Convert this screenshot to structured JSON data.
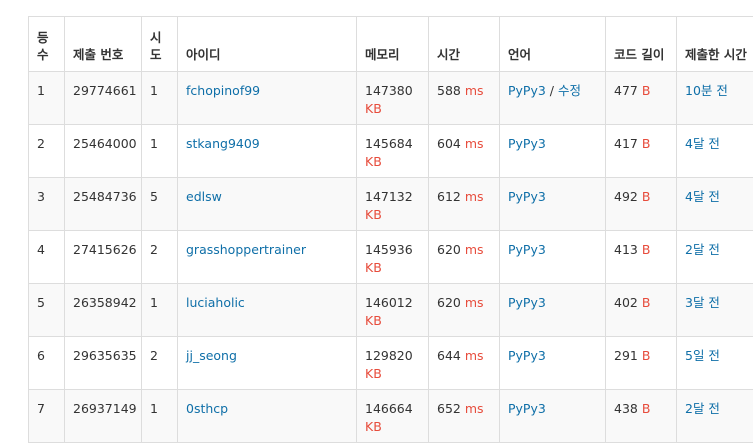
{
  "headers": {
    "rank": "등수",
    "submission_id": "제출 번호",
    "attempts": "시도",
    "user_id": "아이디",
    "memory": "메모리",
    "time": "시간",
    "language": "언어",
    "code_length": "코드 길이",
    "submitted_at": "제출한 시간"
  },
  "units": {
    "memory": "KB",
    "time": "ms",
    "code": "B"
  },
  "rows": [
    {
      "rank": "1",
      "submission_id": "29774661",
      "attempts": "1",
      "user_id": "fchopinof99",
      "memory": "147380",
      "time": "588",
      "language": "PyPy3",
      "edit": "수정",
      "code_length": "477",
      "submitted_at": "10분 전"
    },
    {
      "rank": "2",
      "submission_id": "25464000",
      "attempts": "1",
      "user_id": "stkang9409",
      "memory": "145684",
      "time": "604",
      "language": "PyPy3",
      "edit": "",
      "code_length": "417",
      "submitted_at": "4달 전"
    },
    {
      "rank": "3",
      "submission_id": "25484736",
      "attempts": "5",
      "user_id": "edlsw",
      "memory": "147132",
      "time": "612",
      "language": "PyPy3",
      "edit": "",
      "code_length": "492",
      "submitted_at": "4달 전"
    },
    {
      "rank": "4",
      "submission_id": "27415626",
      "attempts": "2",
      "user_id": "grasshoppertrainer",
      "memory": "145936",
      "time": "620",
      "language": "PyPy3",
      "edit": "",
      "code_length": "413",
      "submitted_at": "2달 전"
    },
    {
      "rank": "5",
      "submission_id": "26358942",
      "attempts": "1",
      "user_id": "luciaholic",
      "memory": "146012",
      "time": "620",
      "language": "PyPy3",
      "edit": "",
      "code_length": "402",
      "submitted_at": "3달 전"
    },
    {
      "rank": "6",
      "submission_id": "29635635",
      "attempts": "2",
      "user_id": "jj_seong",
      "memory": "129820",
      "time": "644",
      "language": "PyPy3",
      "edit": "",
      "code_length": "291",
      "submitted_at": "5일 전"
    },
    {
      "rank": "7",
      "submission_id": "26937149",
      "attempts": "1",
      "user_id": "0sthcp",
      "memory": "146664",
      "time": "652",
      "language": "PyPy3",
      "edit": "",
      "code_length": "438",
      "submitted_at": "2달 전"
    }
  ]
}
